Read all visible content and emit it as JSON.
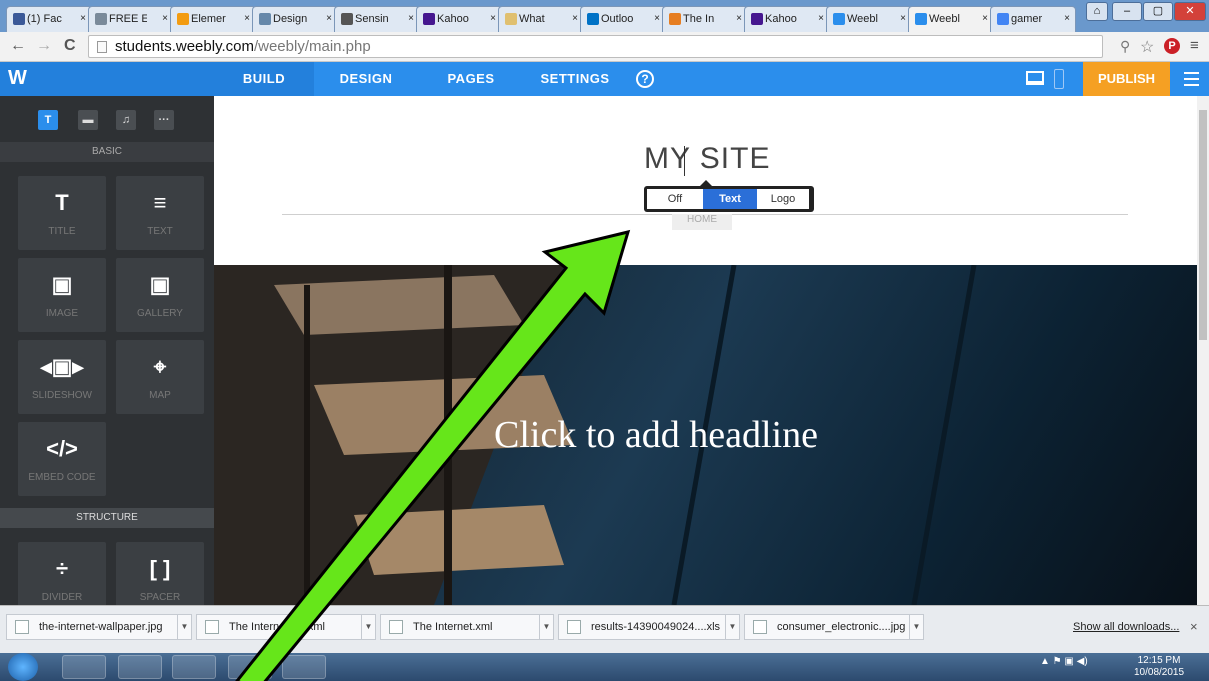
{
  "browser": {
    "tabs": [
      {
        "title": "(1) Fac",
        "icon": "facebook-icon",
        "color": "#3b5998"
      },
      {
        "title": "FREE E",
        "icon": "puzzle-icon",
        "color": "#7a8a9a"
      },
      {
        "title": "Elemer",
        "icon": "edu-icon",
        "color": "#f39c12"
      },
      {
        "title": "Design",
        "icon": "design-icon",
        "color": "#6688aa"
      },
      {
        "title": "Sensin",
        "icon": "sensing-icon",
        "color": "#555555"
      },
      {
        "title": "Kahoo",
        "icon": "kahoot-icon",
        "color": "#46178f"
      },
      {
        "title": "What",
        "icon": "what-icon",
        "color": "#e0c070"
      },
      {
        "title": "Outloo",
        "icon": "outlook-icon",
        "color": "#0072c6"
      },
      {
        "title": "The In",
        "icon": "internet-icon",
        "color": "#e67e22"
      },
      {
        "title": "Kahoo",
        "icon": "kahoot-icon",
        "color": "#46178f"
      },
      {
        "title": "Weebl",
        "icon": "weebly-icon",
        "color": "#2b8eec"
      },
      {
        "title": "Weebl",
        "icon": "weebly-icon",
        "color": "#2b8eec"
      },
      {
        "title": "gamer",
        "icon": "google-icon",
        "color": "#4285f4"
      }
    ],
    "tab_close": "×",
    "url_host": "students.weebly.com",
    "url_path": "/weebly/main.php",
    "back": "←",
    "forward": "→",
    "reload": "C"
  },
  "weebly": {
    "logo": "W",
    "nav": [
      "BUILD",
      "DESIGN",
      "PAGES",
      "SETTINGS"
    ],
    "help": "?",
    "publish": "PUBLISH",
    "accent": "#2b8eec",
    "publish_color": "#f5a023"
  },
  "sidebar": {
    "category_icons": [
      "T",
      "▬",
      "♫",
      "···"
    ],
    "basic_header": "BASIC",
    "structure_header": "STRUCTURE",
    "elements": [
      {
        "icon": "T",
        "label": "TITLE",
        "name": "title"
      },
      {
        "icon": "≡",
        "label": "TEXT",
        "name": "text"
      },
      {
        "icon": "▣",
        "label": "IMAGE",
        "name": "image"
      },
      {
        "icon": "▣",
        "label": "GALLERY",
        "name": "gallery"
      },
      {
        "icon": "◂▣▸",
        "label": "SLIDESHOW",
        "name": "slideshow"
      },
      {
        "icon": "⌖",
        "label": "MAP",
        "name": "map"
      },
      {
        "icon": "</>",
        "label": "EMBED CODE",
        "name": "embed-code"
      },
      {
        "icon": "÷",
        "label": "DIVIDER",
        "name": "divider"
      },
      {
        "icon": "[ ]",
        "label": "SPACER",
        "name": "spacer"
      }
    ]
  },
  "canvas": {
    "site_title": "MY SITE",
    "title_toggle": {
      "options": [
        "Off",
        "Text",
        "Logo"
      ],
      "selected": "Text"
    },
    "home_nav": "HOME",
    "headline": "Click to add headline"
  },
  "downloads": {
    "items": [
      "the-internet-wallpaper.jpg",
      "The Internet (1).xml",
      "The Internet.xml",
      "results-14390049024....xls",
      "consumer_electronic....jpg"
    ],
    "show_all": "Show all downloads...",
    "close": "×"
  },
  "taskbar": {
    "time": "12:15 PM",
    "date": "10/08/2015"
  }
}
